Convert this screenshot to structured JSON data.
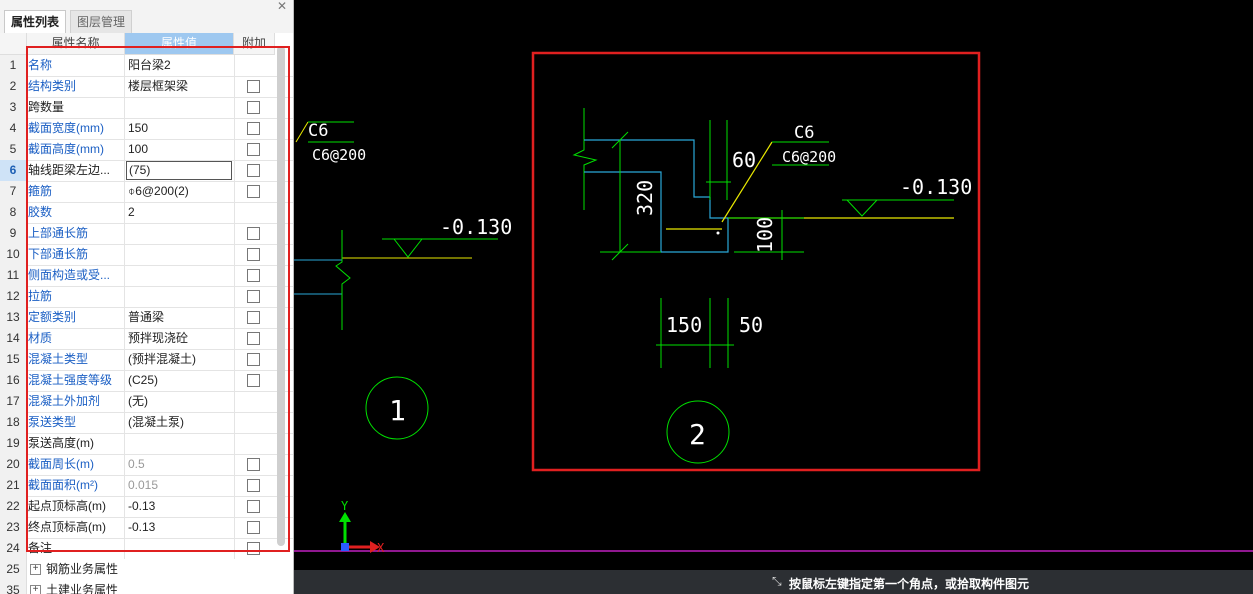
{
  "tabs": {
    "properties": "属性列表",
    "layers": "图层管理"
  },
  "close_glyph": "✕",
  "columns": {
    "name": "属性名称",
    "value": "属性值",
    "extra": "附加"
  },
  "rows": [
    {
      "n": "1",
      "name": "名称",
      "value": "阳台梁2",
      "check": false,
      "blue": true
    },
    {
      "n": "2",
      "name": "结构类别",
      "value": "楼层框架梁",
      "check": true,
      "blue": true
    },
    {
      "n": "3",
      "name": "跨数量",
      "value": "",
      "check": true,
      "blue": false
    },
    {
      "n": "4",
      "name": "截面宽度(mm)",
      "value": "150",
      "check": true,
      "blue": true
    },
    {
      "n": "5",
      "name": "截面高度(mm)",
      "value": "100",
      "check": true,
      "blue": true
    },
    {
      "n": "6",
      "name": "轴线距梁左边...",
      "value": "(75)",
      "check": true,
      "blue": false,
      "editing": true,
      "current": true
    },
    {
      "n": "7",
      "name": "箍筋",
      "value": "⌽6@200(2)",
      "check": true,
      "blue": true
    },
    {
      "n": "8",
      "name": "胶数",
      "value": "2",
      "check": false,
      "blue": true
    },
    {
      "n": "9",
      "name": "上部通长筋",
      "value": "",
      "check": true,
      "blue": true
    },
    {
      "n": "10",
      "name": "下部通长筋",
      "value": "",
      "check": true,
      "blue": true
    },
    {
      "n": "11",
      "name": "侧面构造或受...",
      "value": "",
      "check": true,
      "blue": true
    },
    {
      "n": "12",
      "name": "拉筋",
      "value": "",
      "check": true,
      "blue": true
    },
    {
      "n": "13",
      "name": "定额类别",
      "value": "普通梁",
      "check": true,
      "blue": true
    },
    {
      "n": "14",
      "name": "材质",
      "value": "预拌现浇砼",
      "check": true,
      "blue": true
    },
    {
      "n": "15",
      "name": "混凝土类型",
      "value": "(预拌混凝土)",
      "check": true,
      "blue": true
    },
    {
      "n": "16",
      "name": "混凝土强度等级",
      "value": "(C25)",
      "check": true,
      "blue": true
    },
    {
      "n": "17",
      "name": "混凝土外加剂",
      "value": "(无)",
      "check": false,
      "blue": true
    },
    {
      "n": "18",
      "name": "泵送类型",
      "value": "(混凝土泵)",
      "check": false,
      "blue": true
    },
    {
      "n": "19",
      "name": "泵送高度(m)",
      "value": "",
      "check": false,
      "blue": false
    },
    {
      "n": "20",
      "name": "截面周长(m)",
      "value": "0.5",
      "check": true,
      "blue": true,
      "gray": true
    },
    {
      "n": "21",
      "name": "截面面积(m²)",
      "value": "0.015",
      "check": true,
      "blue": true,
      "gray": true
    },
    {
      "n": "22",
      "name": "起点顶标高(m)",
      "value": "-0.13",
      "check": true,
      "blue": false
    },
    {
      "n": "23",
      "name": "终点顶标高(m)",
      "value": "-0.13",
      "check": true,
      "blue": false
    },
    {
      "n": "24",
      "name": "备注",
      "value": "",
      "check": true,
      "blue": false
    }
  ],
  "groups": [
    {
      "n": "25",
      "label": "钢筋业务属性"
    },
    {
      "n": "35",
      "label": "土建业务属性"
    }
  ],
  "canvas": {
    "left_detail": {
      "rebar_top": "C6",
      "rebar_bottom": "C6@200",
      "elevation": "-0.130",
      "number": "1"
    },
    "right_detail": {
      "rebar_top": "C6",
      "rebar_bottom": "C6@200",
      "elevation": "-0.130",
      "number": "2",
      "dim_60": "60",
      "dim_320": "320",
      "dim_100": "100",
      "dim_150": "150",
      "dim_50": "50"
    },
    "axis_x": "X",
    "axis_y": "Y"
  },
  "status": {
    "text": "按鼠标左键指定第一个角点，或拾取构件图元",
    "icon": "cursor-icon"
  },
  "colors": {
    "highlight_red": "#e02020",
    "cad_green": "#00e000",
    "cad_cyan": "#2aa8d8",
    "cad_yellow": "#e8e800"
  }
}
